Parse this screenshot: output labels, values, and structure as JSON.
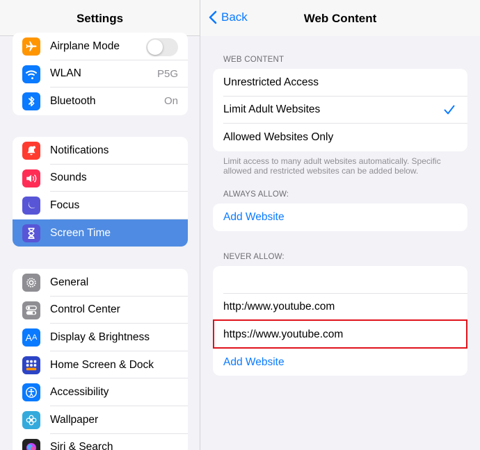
{
  "sidebar": {
    "title": "Settings",
    "group1": [
      {
        "label": "Airplane Mode",
        "icon": "airplane-icon",
        "color": "#ff9500",
        "toggle": false
      },
      {
        "label": "WLAN",
        "icon": "wifi-icon",
        "color": "#0a7aff",
        "value": "P5G"
      },
      {
        "label": "Bluetooth",
        "icon": "bluetooth-icon",
        "color": "#0a7aff",
        "value": "On"
      }
    ],
    "group2": [
      {
        "label": "Notifications",
        "icon": "bell-icon",
        "color": "#ff3b30"
      },
      {
        "label": "Sounds",
        "icon": "speaker-icon",
        "color": "#ff2d55"
      },
      {
        "label": "Focus",
        "icon": "moon-icon",
        "color": "#5856d6"
      },
      {
        "label": "Screen Time",
        "icon": "hourglass-icon",
        "color": "#5856d6",
        "active": true
      }
    ],
    "group3": [
      {
        "label": "General",
        "icon": "gear-icon",
        "color": "#8e8e93"
      },
      {
        "label": "Control Center",
        "icon": "switches-icon",
        "color": "#8e8e93"
      },
      {
        "label": "Display & Brightness",
        "icon": "text-size-icon",
        "color": "#0a7aff"
      },
      {
        "label": "Home Screen & Dock",
        "icon": "app-grid-icon",
        "color": "#2c44c5"
      },
      {
        "label": "Accessibility",
        "icon": "accessibility-icon",
        "color": "#0a7aff"
      },
      {
        "label": "Wallpaper",
        "icon": "flower-icon",
        "color": "#34aadc"
      },
      {
        "label": "Siri & Search",
        "icon": "siri-icon",
        "color": "#222"
      }
    ]
  },
  "detail": {
    "back_label": "Back",
    "title": "Web Content",
    "web_content_header": "WEB CONTENT",
    "options": [
      {
        "label": "Unrestricted Access",
        "selected": false
      },
      {
        "label": "Limit Adult Websites",
        "selected": true
      },
      {
        "label": "Allowed Websites Only",
        "selected": false
      }
    ],
    "web_content_footer": "Limit access to many adult websites automatically. Specific allowed and restricted websites can be added below.",
    "always_allow_header": "ALWAYS ALLOW:",
    "always_allow_add": "Add Website",
    "never_allow_header": "NEVER ALLOW:",
    "never_allow_items": [
      "",
      "http:/www.youtube.com",
      "https://www.youtube.com"
    ],
    "never_allow_add": "Add Website"
  },
  "colors": {
    "accent": "#0a7aff",
    "active_row": "#4f8be2",
    "highlight_border": "#e0121b"
  }
}
